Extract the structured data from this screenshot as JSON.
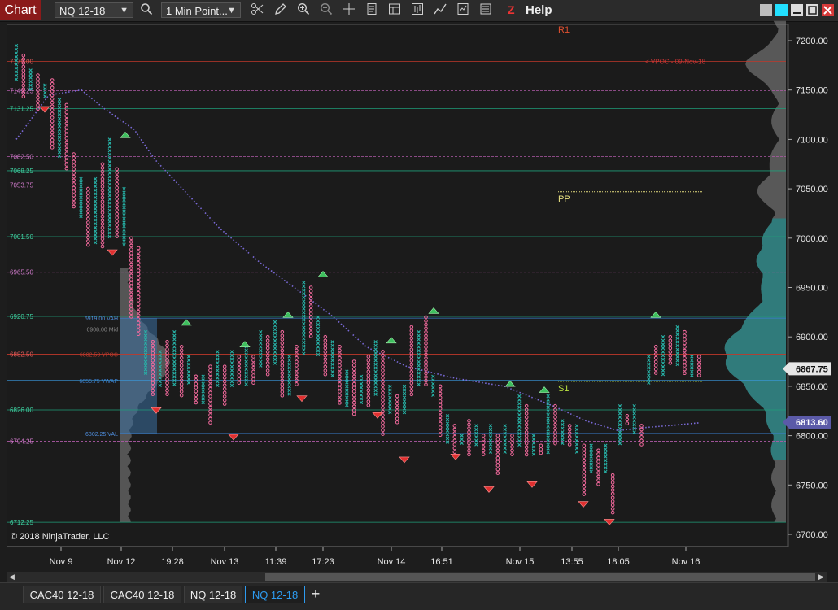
{
  "toolbar": {
    "chart_label": "Chart",
    "instrument": "NQ 12-18",
    "interval": "1 Min Point...",
    "help_label": "Help",
    "z_label": "Z",
    "icons": [
      "search-icon",
      "crosshair-icon",
      "pencil-icon",
      "zoom-in-icon",
      "zoom-out-icon",
      "crosshair-plus-icon",
      "properties-icon",
      "data-box-icon",
      "chart-style-icon",
      "strategies-icon",
      "indicator-icon",
      "templates-icon"
    ]
  },
  "chart": {
    "copyright": "© 2018 NinjaTrader, LLC",
    "pivots": [
      {
        "label": "R1",
        "price": 7213
      },
      {
        "label": "PP",
        "price": 7042
      },
      {
        "label": "S1",
        "price": 6850
      }
    ],
    "y_ticks": [
      "7200.00",
      "7150.00",
      "7100.00",
      "7050.00",
      "7000.00",
      "6950.00",
      "6900.00",
      "6850.00",
      "6800.00",
      "6750.00",
      "6700.00"
    ],
    "x_ticks": [
      "Nov 9",
      "Nov 12",
      "19:28",
      "Nov 13",
      "11:39",
      "17:23",
      "Nov 14",
      "16:51",
      "Nov 15",
      "13:55",
      "18:05",
      "Nov 16"
    ],
    "price_badges": [
      {
        "price": 6867.75,
        "text": "6867.75"
      },
      {
        "price": 6813.6,
        "text": "6813.60"
      }
    ],
    "levels": [
      {
        "price": 7179.0,
        "text": "7179.00",
        "right_text": "< VPOC - 09-Nov-18"
      },
      {
        "price": 7149.25,
        "text": "7149.25"
      },
      {
        "price": 7131.25,
        "text": "7131.25"
      },
      {
        "price": 7082.5,
        "text": "7082.50"
      },
      {
        "price": 7068.25,
        "text": "7068.25"
      },
      {
        "price": 7053.75,
        "text": "7053.75"
      },
      {
        "price": 7001.5,
        "text": "7001.50"
      },
      {
        "price": 6965.5,
        "text": "6965.50"
      },
      {
        "price": 6920.75,
        "text": "6920.75"
      },
      {
        "price": 6882.5,
        "text": "6882.50"
      },
      {
        "price": 6826.0,
        "text": "6826.00"
      },
      {
        "price": 6794.25,
        "text": "6794.25"
      },
      {
        "price": 6712.25,
        "text": "6712.25"
      }
    ],
    "profile_labels": [
      {
        "price": 6919.0,
        "text": "6919.00 VAH"
      },
      {
        "price": 6908.0,
        "text": "6908.00 Mid"
      },
      {
        "price": 6882.5,
        "text": "6882.50 VPOC"
      },
      {
        "price": 6855.75,
        "text": "6855.75 VWAP"
      },
      {
        "price": 6802.25,
        "text": "6802.25 VAL"
      }
    ]
  },
  "tabs": [
    {
      "label": "CAC40 12-18",
      "active": false
    },
    {
      "label": "CAC40 12-18",
      "active": false
    },
    {
      "label": "NQ 12-18",
      "active": false
    },
    {
      "label": "NQ 12-18",
      "active": true
    }
  ],
  "add_tab_label": "+",
  "colors": {
    "x_color": "#27b3a8",
    "o_color": "#f56a9e",
    "vwap_color": "#7a6ad8",
    "current_price_bg": "#e6e6e6",
    "vwap_badge_bg": "#5b5aa8",
    "accent": "#2d9bf0",
    "chart_tab_bg": "#8b1a1a"
  }
}
